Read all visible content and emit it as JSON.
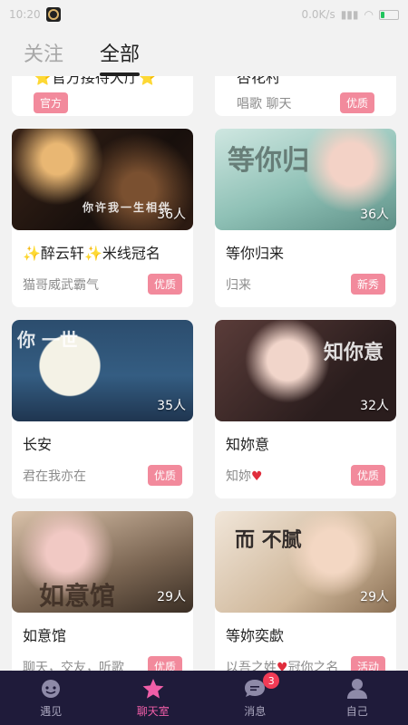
{
  "status_bar": {
    "time": "10:20",
    "network": "0.0K/s",
    "battery_level": 0.18
  },
  "tabs": [
    {
      "label": "关注",
      "active": false
    },
    {
      "label": "全部",
      "active": true
    }
  ],
  "partial_cards": [
    {
      "title": "⭐官方接待大厅⭐",
      "badge": "官方"
    },
    {
      "title": "杏花村",
      "subtitle": "唱歌 聊天",
      "badge": "优质"
    }
  ],
  "rooms": [
    {
      "title_prefix": "✨",
      "title": "醉云轩",
      "title_mid": "✨",
      "title_suffix": "米线冠名",
      "subtitle": "猫哥威武霸气",
      "count": "36人",
      "badge": "优质",
      "art_text": "你许我一生相伴"
    },
    {
      "title": "等你归来",
      "subtitle": "归来",
      "count": "36人",
      "badge": "新秀",
      "art_text": "等你归"
    },
    {
      "title": "长安",
      "subtitle": "君在我亦在",
      "count": "35人",
      "badge": "优质",
      "art_text": "你 一世"
    },
    {
      "title": "知妳意",
      "subtitle": "知妳",
      "subtitle_heart": "♥",
      "count": "32人",
      "badge": "优质",
      "art_text": "知你意"
    },
    {
      "title": "如意馆",
      "subtitle": "聊天，交友，听歌",
      "count": "29人",
      "badge": "优质",
      "art_text": "如意馆"
    },
    {
      "title": "等妳奕歔",
      "subtitle": "以吾之姓",
      "subtitle_heart": "♥",
      "subtitle_suffix": "冠你之名",
      "count": "29人",
      "badge": "活动",
      "art_text": "而 不腻"
    }
  ],
  "bottom_nav": [
    {
      "label": "遇见",
      "icon": "meet-icon",
      "active": false
    },
    {
      "label": "聊天室",
      "icon": "star-icon",
      "active": true
    },
    {
      "label": "消息",
      "icon": "message-icon",
      "active": false,
      "badge": "3"
    },
    {
      "label": "自己",
      "icon": "profile-icon",
      "active": false
    }
  ],
  "colors": {
    "nav_bg": "#1f1b3a",
    "accent": "#f05ea8",
    "badge": "#f28a9c",
    "heart": "#e02d3c"
  }
}
